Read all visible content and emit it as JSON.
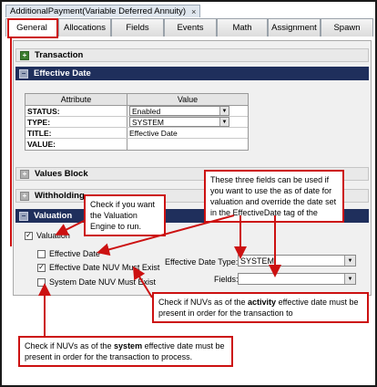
{
  "document_tab": {
    "title": "AdditionalPayment(Variable Deferred Annuity)",
    "close_glyph": "×"
  },
  "tabs": [
    "General",
    "Allocations",
    "Fields",
    "Events",
    "Math",
    "Assignment",
    "Spawn"
  ],
  "sections": {
    "transaction": {
      "label": "Transaction",
      "toggle": "+"
    },
    "effective_date": {
      "label": "Effective Date",
      "toggle": "−"
    },
    "values_block": {
      "label": "Values Block",
      "toggle": "+"
    },
    "withholding": {
      "label": "Withholding",
      "toggle": "+"
    },
    "valuation": {
      "label": "Valuation",
      "toggle": "−"
    }
  },
  "attribute_grid": {
    "headers": {
      "attribute": "Attribute",
      "value": "Value"
    },
    "rows": [
      {
        "attribute": "STATUS:",
        "value": "Enabled"
      },
      {
        "attribute": "TYPE:",
        "value": "SYSTEM"
      },
      {
        "attribute": "TITLE:",
        "value": "Effective Date"
      },
      {
        "attribute": "VALUE:",
        "value": ""
      }
    ]
  },
  "valuation": {
    "valuation_checkbox": {
      "label": "Valuation",
      "checked": true
    },
    "effective_date_checkbox": {
      "label": "Effective Date",
      "checked": false
    },
    "nuv_must_exist_checkbox": {
      "label": "Effective Date NUV Must Exist",
      "checked": true
    },
    "system_nuv_checkbox": {
      "label": "System Date NUV Must Exist",
      "checked": false
    },
    "effective_date_type": {
      "label": "Effective Date Type:",
      "value": "SYSTEM"
    },
    "fields": {
      "label": "Fields:",
      "value": ""
    }
  },
  "callouts": {
    "valuation_engine": "Check if you want the Valuation Engine to run.",
    "three_fields": "These three fields can be used if you want to use the as of date for valuation and override the date set in the EffectiveDate tag of the",
    "activity": {
      "before": "Check if NUVs as of the ",
      "bold": "activity",
      "after": " effective date must be present in order for the transaction to"
    },
    "system": {
      "before": "Check if NUVs as of the ",
      "bold": "system",
      "after": " effective date must be present in order for the transaction to process."
    }
  },
  "colors": {
    "section_dark": "#1f2f5c",
    "callout_border": "#cc1111",
    "section_light": "#e9e9e9"
  }
}
